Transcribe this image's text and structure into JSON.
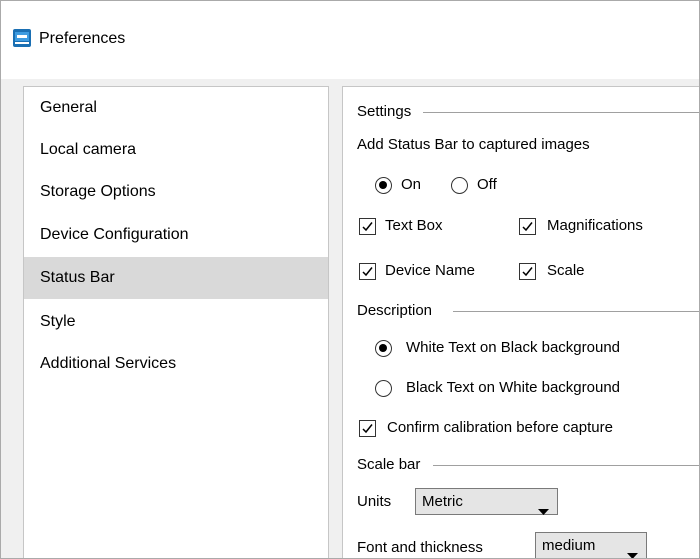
{
  "window": {
    "title": "Preferences"
  },
  "nav": {
    "items": [
      "General",
      "Local camera",
      "Storage Options",
      "Device Configuration",
      "Status Bar",
      "Style",
      "Additional Services"
    ],
    "selected": "Status Bar"
  },
  "settings": {
    "group_title": "Settings",
    "add_status_bar_label": "Add Status Bar to captured images",
    "on_label": "On",
    "off_label": "Off",
    "status_bar_value": "On",
    "text_box_label": "Text Box",
    "text_box_checked": true,
    "magnifications_label": "Magnifications",
    "magnifications_checked": true,
    "device_name_label": "Device Name",
    "device_name_checked": true,
    "scale_label": "Scale",
    "scale_checked": true
  },
  "description": {
    "group_title": "Description",
    "white_text_label": "White Text on Black background",
    "black_text_label": "Black Text on White background",
    "selected": "White Text on Black background",
    "confirm_calibration_label": "Confirm calibration before capture",
    "confirm_calibration_checked": true
  },
  "scale_bar": {
    "group_title": "Scale bar",
    "units_label": "Units",
    "units_value": "Metric",
    "font_thickness_label": "Font and thickness",
    "font_thickness_value": "medium"
  }
}
